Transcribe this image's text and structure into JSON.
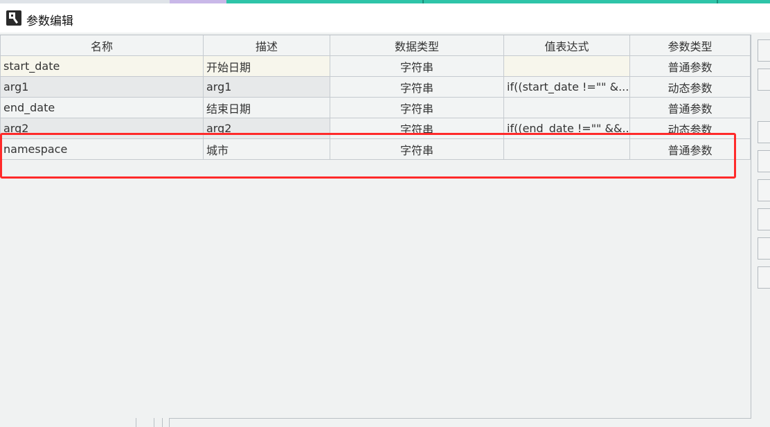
{
  "dialog": {
    "title": "参数编辑",
    "icon": "report-app-icon"
  },
  "table": {
    "columns": [
      "名称",
      "描述",
      "数据类型",
      "值表达式",
      "参数类型"
    ],
    "rows": [
      {
        "name": "start_date",
        "description": "开始日期",
        "data_type": "字符串",
        "expression": "",
        "param_type": "普通参数"
      },
      {
        "name": "arg1",
        "description": "arg1",
        "data_type": "字符串",
        "expression": "if((start_date !=\"\" &...",
        "param_type": "动态参数"
      },
      {
        "name": "end_date",
        "description": "结束日期",
        "data_type": "字符串",
        "expression": "",
        "param_type": "普通参数"
      },
      {
        "name": "arg2",
        "description": "arg2",
        "data_type": "字符串",
        "expression": "if((end_date !=\"\" &&...",
        "param_type": "动态参数"
      },
      {
        "name": "namespace",
        "description": "城市",
        "data_type": "字符串",
        "expression": "",
        "param_type": "普通参数"
      }
    ]
  },
  "highlight": {
    "color": "#ff2a2a"
  },
  "colors": {
    "panel_bg": "#f0f2f2",
    "grid_line": "#c5cacf",
    "selected_row_bg": "#f7f6ec"
  }
}
